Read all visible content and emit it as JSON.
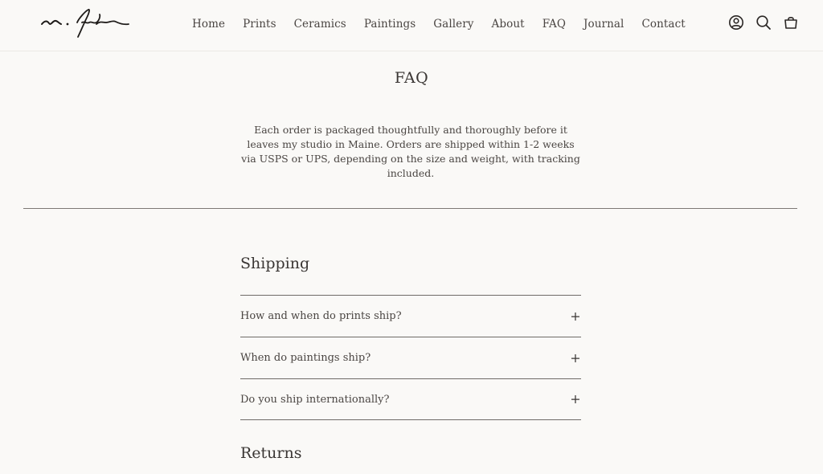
{
  "nav": {
    "items": [
      {
        "label": "Home"
      },
      {
        "label": "Prints"
      },
      {
        "label": "Ceramics"
      },
      {
        "label": "Paintings"
      },
      {
        "label": "Gallery"
      },
      {
        "label": "About"
      },
      {
        "label": "FAQ"
      },
      {
        "label": "Journal"
      },
      {
        "label": "Contact"
      }
    ]
  },
  "icons": {
    "account": "account-icon",
    "search": "search-icon",
    "cart": "cart-icon"
  },
  "page": {
    "title": "FAQ",
    "intro": "Each order is packaged thoughtfully and thoroughly before it leaves my studio in Maine. Orders are shipped within 1-2 weeks via USPS or UPS, depending on the size and weight, with tracking included."
  },
  "sections": [
    {
      "title": "Shipping",
      "questions": [
        {
          "q": "How and when do prints ship?",
          "toggle": "+"
        },
        {
          "q": "When do paintings ship?",
          "toggle": "+"
        },
        {
          "q": "Do you ship internationally?",
          "toggle": "+"
        }
      ]
    },
    {
      "title": "Returns",
      "questions": []
    }
  ]
}
